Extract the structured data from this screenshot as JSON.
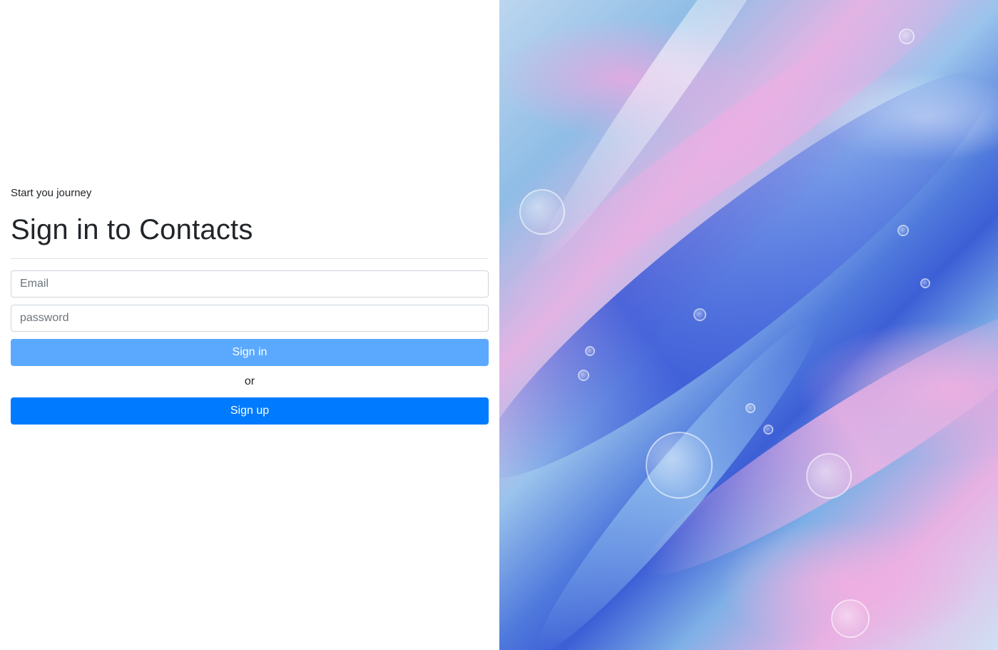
{
  "auth": {
    "subtitle": "Start you journey",
    "title": "Sign in to Contacts",
    "email_placeholder": "Email",
    "password_placeholder": "password",
    "signin_label": "Sign in",
    "or_label": "or",
    "signup_label": "Sign up"
  },
  "theme": {
    "signin_color": "#5aa9ff",
    "signup_color": "#007bff"
  }
}
